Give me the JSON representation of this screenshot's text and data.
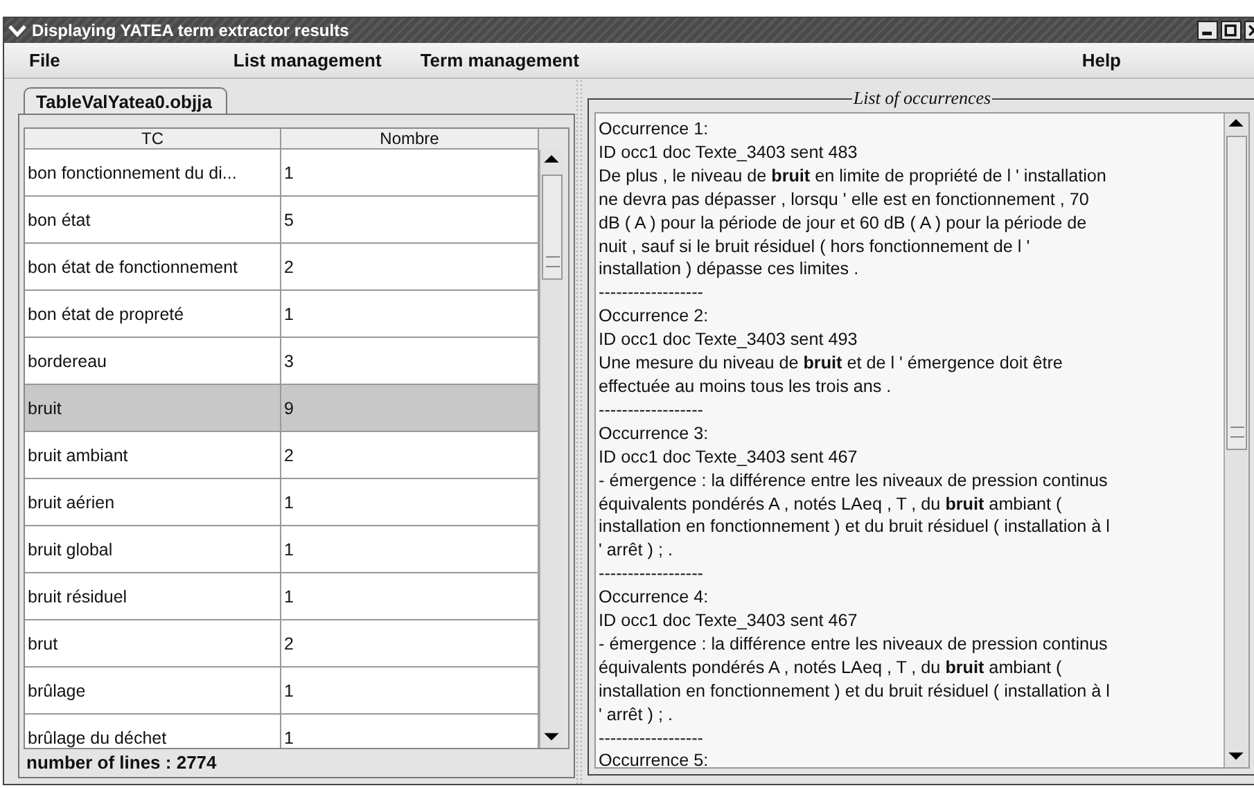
{
  "window": {
    "title": "Displaying YATEA term extractor results"
  },
  "menu": [
    {
      "label": "File"
    },
    {
      "label": "List management"
    },
    {
      "label": "Term management"
    },
    {
      "label": "Help"
    }
  ],
  "left_panel": {
    "tab": {
      "label": "TableValYatea0.objja",
      "selected": true
    },
    "table": {
      "columns": [
        "TC",
        "Nombre"
      ],
      "rows": [
        {
          "cells": [
            "bon fonctionnement du di...",
            "1"
          ],
          "selected": false
        },
        {
          "cells": [
            "bon état",
            "5"
          ],
          "selected": false
        },
        {
          "cells": [
            "bon état de fonctionnement",
            "2"
          ],
          "selected": false
        },
        {
          "cells": [
            "bon état de propreté",
            "1"
          ],
          "selected": false
        },
        {
          "cells": [
            "bordereau",
            "3"
          ],
          "selected": false
        },
        {
          "cells": [
            "bruit",
            "9"
          ],
          "selected": true
        },
        {
          "cells": [
            "bruit ambiant",
            "2"
          ],
          "selected": false
        },
        {
          "cells": [
            "bruit aérien",
            "1"
          ],
          "selected": false
        },
        {
          "cells": [
            "bruit global",
            "1"
          ],
          "selected": false
        },
        {
          "cells": [
            "bruit résiduel",
            "1"
          ],
          "selected": false
        },
        {
          "cells": [
            "brut",
            "2"
          ],
          "selected": false
        },
        {
          "cells": [
            "brûlage",
            "1"
          ],
          "selected": false
        },
        {
          "cells": [
            "brûlage du déchet",
            "1"
          ],
          "selected": false
        }
      ]
    },
    "status": "number of lines : 2774"
  },
  "right_panel": {
    "title": "List of occurrences",
    "occurrences": [
      {
        "heading": "Occurrence 1:",
        "id": "ID occ1 doc Texte_3403 sent 483",
        "sentence": [
          "De plus , le niveau de **bruit** en limite de propriété de l ' installation",
          "ne devra pas dépasser , lorsqu ' elle est en fonctionnement , 70",
          "dB ( A ) pour la période de jour et 60 dB ( A ) pour la période de",
          "nuit , sauf si le bruit résiduel ( hors fonctionnement de l '",
          "installation ) dépasse ces limites ."
        ],
        "separator": "------------------"
      },
      {
        "heading": "Occurrence 2:",
        "id": "ID occ1 doc Texte_3403 sent 493",
        "sentence": [
          "Une mesure du niveau de **bruit** et de l ' émergence doit être",
          "effectuée au moins tous les trois ans ."
        ],
        "separator": "------------------"
      },
      {
        "heading": "Occurrence 3:",
        "id": "ID occ1 doc Texte_3403 sent 467",
        "sentence": [
          "- émergence : la différence entre les niveaux de pression continus",
          "équivalents pondérés A , notés LAeq , T , du **bruit** ambiant (",
          "installation en fonctionnement ) et du bruit résiduel ( installation à l",
          "' arrêt ) ; ."
        ],
        "separator": "------------------"
      },
      {
        "heading": "Occurrence 4:",
        "id": "ID occ1 doc Texte_3403 sent 467",
        "sentence": [
          "- émergence : la différence entre les niveaux de pression continus",
          "équivalents pondérés A , notés LAeq , T , du **bruit** ambiant (",
          "installation en fonctionnement ) et du bruit résiduel ( installation à l",
          "' arrêt ) ; ."
        ],
        "separator": "------------------"
      },
      {
        "heading": "Occurrence 5:"
      }
    ]
  }
}
